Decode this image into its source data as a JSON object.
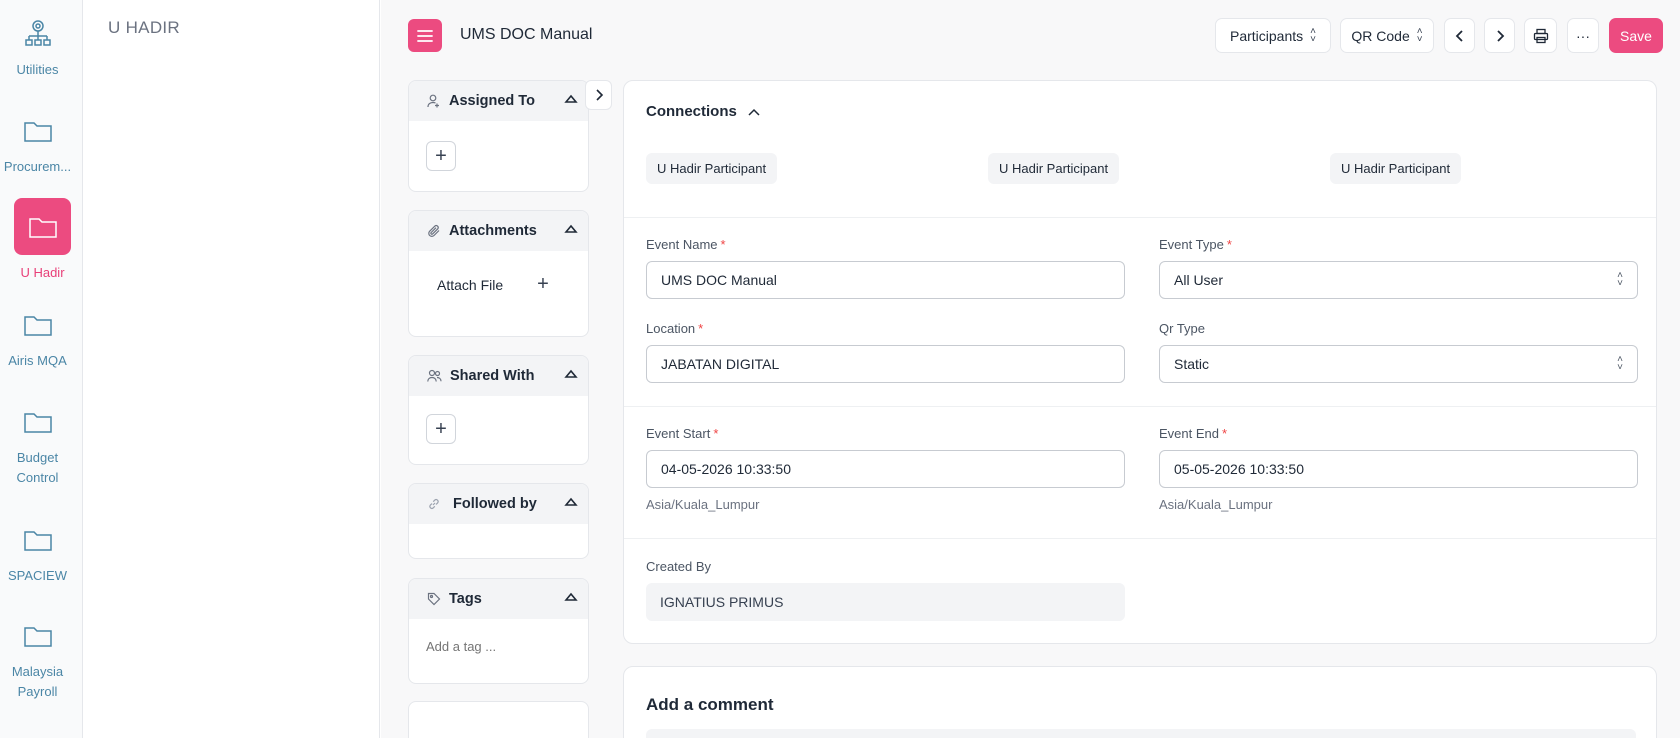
{
  "rail": {
    "items": [
      {
        "label": "Utilities"
      },
      {
        "label": "Procurem..."
      },
      {
        "label": "U Hadir"
      },
      {
        "label": "Airis MQA"
      },
      {
        "label": "Budget\nControl"
      },
      {
        "label": "SPACIEW"
      },
      {
        "label": "Malaysia\nPayroll"
      }
    ],
    "active_index": 2
  },
  "module": {
    "title": "U HADIR"
  },
  "header": {
    "doc_title": "UMS DOC Manual",
    "participants_label": "Participants",
    "qr_code_label": "QR Code",
    "more_label": "···",
    "save_label": "Save"
  },
  "sidebar": {
    "assigned_to": {
      "label": "Assigned To",
      "icon": "user-add-icon"
    },
    "attachments": {
      "label": "Attachments",
      "attach_file_label": "Attach File",
      "icon": "paperclip-icon"
    },
    "shared_with": {
      "label": "Shared With",
      "icon": "users-icon"
    },
    "followed_by": {
      "label": "Followed by",
      "icon": "link-icon"
    },
    "tags": {
      "label": "Tags",
      "placeholder": "Add a tag ...",
      "icon": "tag-icon"
    }
  },
  "connections": {
    "title": "Connections",
    "pills": [
      "U Hadir Participant",
      "U Hadir Participant",
      "U Hadir Participant"
    ]
  },
  "form": {
    "event_name": {
      "label": "Event Name",
      "value": "UMS DOC Manual"
    },
    "event_type": {
      "label": "Event Type",
      "value": "All User"
    },
    "location": {
      "label": "Location",
      "value": "JABATAN DIGITAL"
    },
    "qr_type": {
      "label": "Qr Type",
      "value": "Static"
    },
    "event_start": {
      "label": "Event Start",
      "value": "04-05-2026 10:33:50",
      "timezone": "Asia/Kuala_Lumpur"
    },
    "event_end": {
      "label": "Event End",
      "value": "05-05-2026 10:33:50",
      "timezone": "Asia/Kuala_Lumpur"
    },
    "created_by": {
      "label": "Created By",
      "value": "IGNATIUS PRIMUS"
    }
  },
  "comment": {
    "title": "Add a comment"
  },
  "colors": {
    "accent": "#ec4b80",
    "rail_text": "#4b86a6"
  }
}
